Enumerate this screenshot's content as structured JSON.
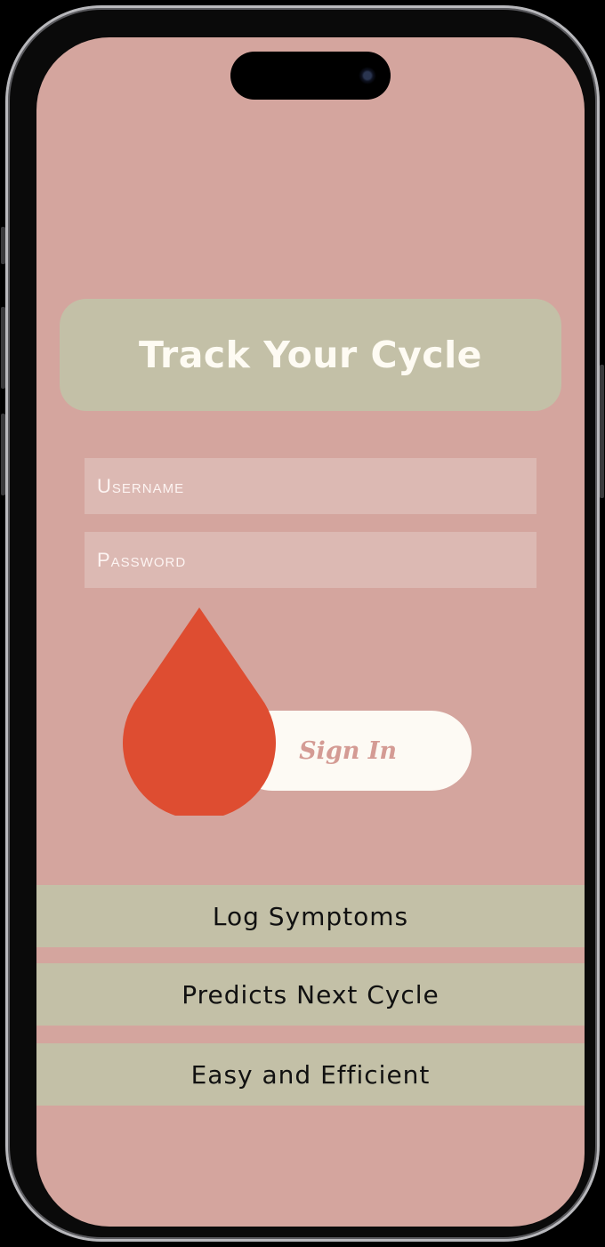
{
  "app": {
    "title": "Track Your Cycle"
  },
  "form": {
    "username": {
      "placeholder": "Username",
      "value": ""
    },
    "password": {
      "placeholder": "Password",
      "value": ""
    }
  },
  "signin": {
    "label": "Sign In",
    "icon": "blood-drop-icon"
  },
  "features": [
    {
      "label": "Log Symptoms"
    },
    {
      "label": "Predicts Next Cycle"
    },
    {
      "label": "Easy and Efficient"
    }
  ],
  "colors": {
    "background": "#d4a59e",
    "card": "#c3c0a7",
    "drop": "#de4d31",
    "pill": "#fdfaf4",
    "signin_text": "#d49b94",
    "title_text": "#fefbf3"
  }
}
